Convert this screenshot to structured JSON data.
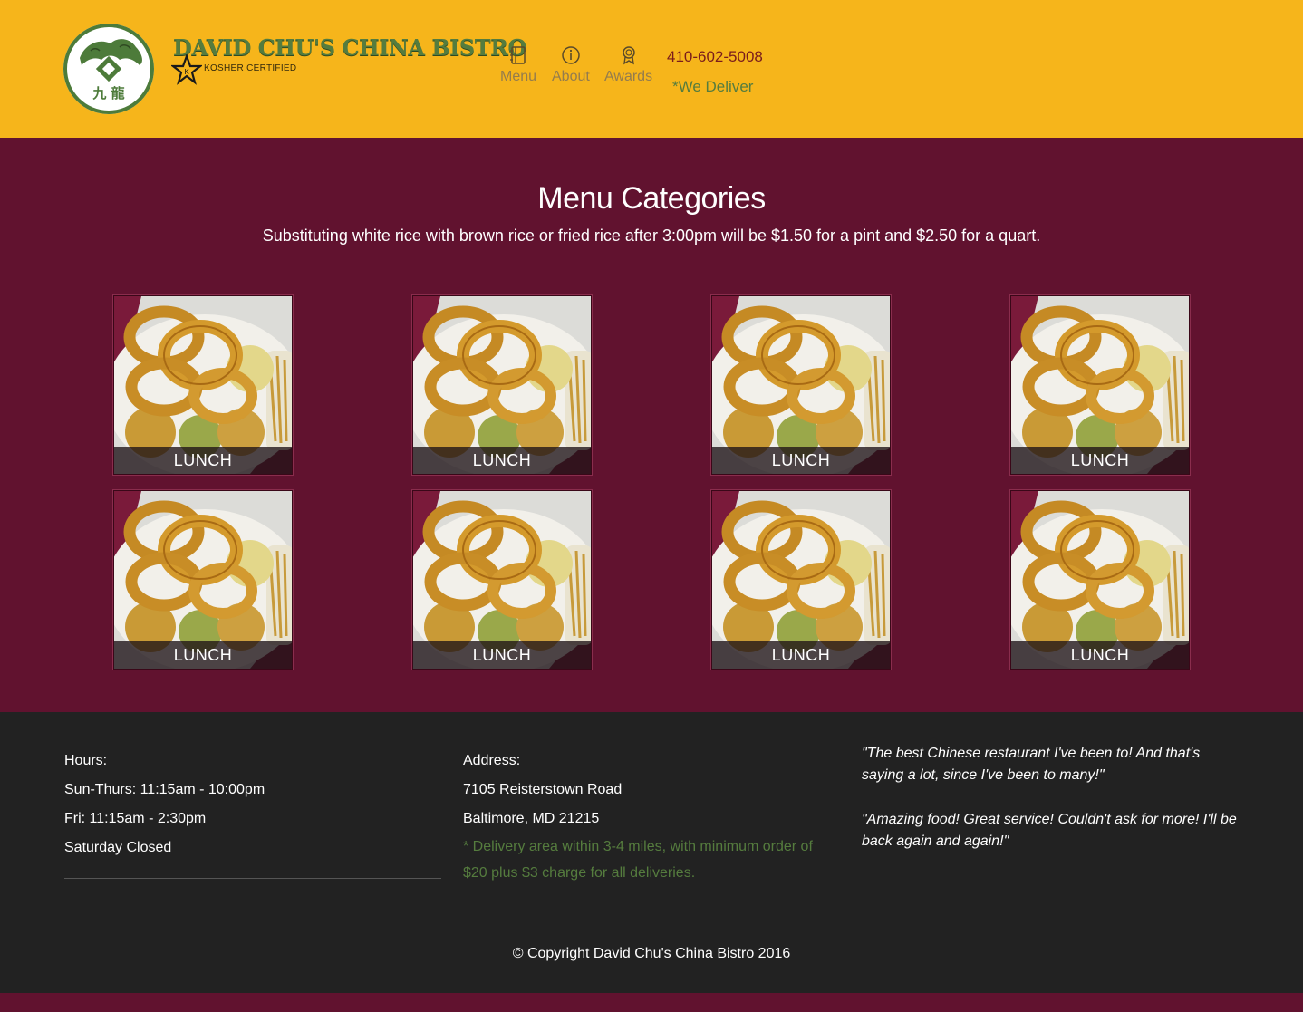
{
  "header": {
    "brand_name": "DAVID CHU'S CHINA BISTRO",
    "kosher_label": "KOSHER CERTIFIED",
    "logo_characters": "九 龍",
    "nav": [
      {
        "label": "Menu",
        "icon": "menu-book-icon"
      },
      {
        "label": "About",
        "icon": "info-icon"
      },
      {
        "label": "Awards",
        "icon": "award-icon"
      }
    ],
    "phone": "410-602-5008",
    "delivery": "*We Deliver"
  },
  "main": {
    "title": "Menu Categories",
    "subtitle": "Substituting white rice with brown rice or fried rice after 3:00pm will be $1.50 for a pint and $2.50 for a quart.",
    "tiles": [
      {
        "label": "LUNCH"
      },
      {
        "label": "LUNCH"
      },
      {
        "label": "LUNCH"
      },
      {
        "label": "LUNCH"
      },
      {
        "label": "LUNCH"
      },
      {
        "label": "LUNCH"
      },
      {
        "label": "LUNCH"
      },
      {
        "label": "LUNCH"
      }
    ]
  },
  "footer": {
    "hours": {
      "heading": "Hours:",
      "lines": [
        "Sun-Thurs: 11:15am - 10:00pm",
        "Fri: 11:15am - 2:30pm",
        "Saturday Closed"
      ]
    },
    "address": {
      "heading": "Address:",
      "lines": [
        "7105 Reisterstown Road",
        "Baltimore, MD 21215"
      ],
      "note": "* Delivery area within 3-4 miles, with minimum order of $20 plus $3 charge for all deliveries."
    },
    "quotes": [
      "\"The best Chinese restaurant I've been to! And that's saying a lot, since I've been to many!\"",
      "\"Amazing food! Great service! Couldn't ask for more! I'll be back again and again!\""
    ],
    "copyright": "© Copyright David Chu's China Bistro 2016"
  },
  "colors": {
    "header_bg": "#f6b51b",
    "main_bg": "#61122f",
    "footer_bg": "#222222",
    "brand_green": "#557c3e",
    "phone_red": "#7a1c1c"
  }
}
